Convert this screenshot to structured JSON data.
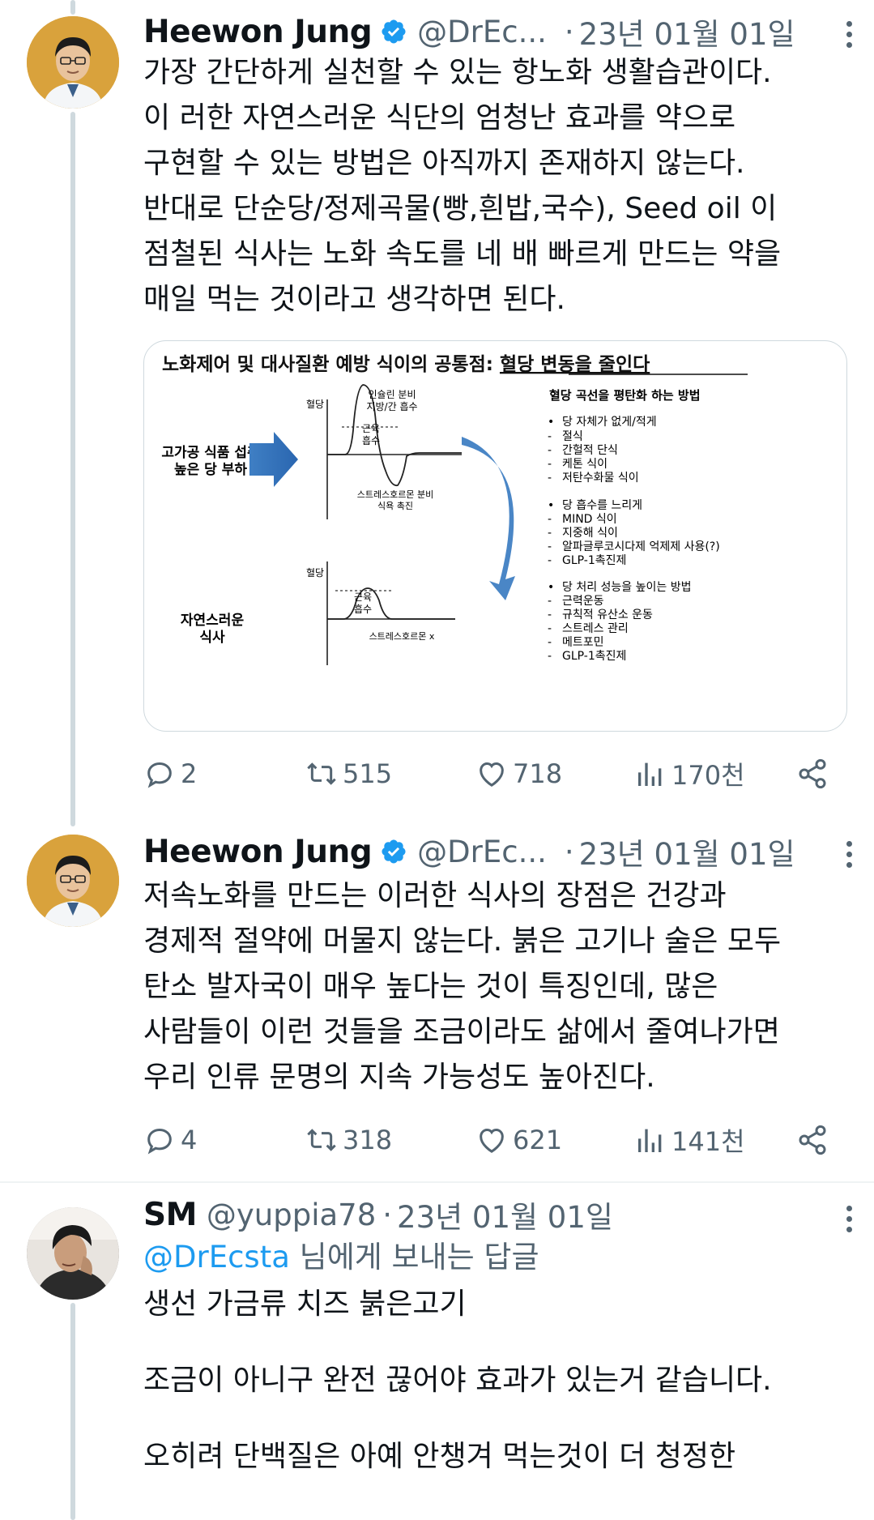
{
  "tweets": [
    {
      "name": "Heewon Jung",
      "handle": "@DrEc...",
      "time": "23년 01월 01일",
      "lines": [
        "가장 간단하게 실천할 수 있는 항노화 생활습관이다.",
        "이 러한 자연스러운 식단의 엄청난 효과를 약으로",
        "구현할 수 있는 방법은 아직까지 존재하지 않는다.",
        "반대로 단순당/정제곡물(빵,흰밥,국수),  Seed oil 이",
        "점철된 식사는 노화 속도를 네 배 빠르게 만드는 약을",
        "매일 먹는 것이라고 생각하면 된다."
      ],
      "stats": {
        "replies": "2",
        "retweets": "515",
        "likes": "718",
        "views": "170천"
      }
    },
    {
      "name": "Heewon Jung",
      "handle": "@DrEc...",
      "time": "23년 01월 01일",
      "lines": [
        "저속노화를 만드는 이러한 식사의 장점은 건강과",
        "경제적 절약에 머물지 않는다. 붉은 고기나 술은 모두",
        "탄소 발자국이 매우 높다는 것이 특징인데, 많은",
        "사람들이 이런 것들을 조금이라도 삶에서 줄여나가면",
        "우리 인류 문명의 지속 가능성도 높아진다."
      ],
      "stats": {
        "replies": "4",
        "retweets": "318",
        "likes": "621",
        "views": "141천"
      }
    },
    {
      "name": "SM",
      "handle": "@yuppia78",
      "time": "23년 01월 01일",
      "reply_mention": "@DrEcsta",
      "reply_suffix": " 님에게 보내는 답글",
      "paragraphs": [
        "생선 가금류 치즈 붉은고기",
        "조금이 아니구 완전 끊어야 효과가 있는거 같습니다.",
        "오히려 단백질은 아예 안챙겨 먹는것이 더 청정한"
      ]
    }
  ],
  "figure": {
    "title_plain": "노화제어 및 대사질환 예방 식이의 공통점: ",
    "title_underlined": "혈당 변동을 줄인다",
    "left_top_l1": "고가공 식품 섭취",
    "left_top_l2": "높은 당 부하",
    "left_bottom_l1": "자연스러운",
    "left_bottom_l2": "식사",
    "axis_label": "혈당",
    "curve1_top_l1": "인슐린 분비",
    "curve1_top_l2": "지방/간 흡수",
    "curve1_inner_l1": "근육",
    "curve1_inner_l2": "흡수",
    "curve1_bottom_l1": "스트레스호르몬 분비",
    "curve1_bottom_l2": "식욕 촉진",
    "curve2_inner_l1": "근육",
    "curve2_inner_l2": "흡수",
    "curve2_bottom": "스트레스호르몬 x",
    "right_title": "혈당 곡선을 평탄화 하는 방법",
    "groups": [
      {
        "head": "당 자체가 없게/적게",
        "items": [
          "절식",
          "간헐적 단식",
          "케톤 식이",
          "저탄수화물 식이"
        ]
      },
      {
        "head": "당 흡수를 느리게",
        "items": [
          "MIND 식이",
          "지중해 식이",
          "알파글루코시다제 억제제 사용(?)",
          "GLP-1촉진제"
        ]
      },
      {
        "head": "당 처리 성능을 높이는 방법",
        "items": [
          "근력운동",
          "규칙적 유산소 운동",
          "스트레스 관리",
          "메트포민",
          "GLP-1촉진제"
        ]
      }
    ]
  }
}
